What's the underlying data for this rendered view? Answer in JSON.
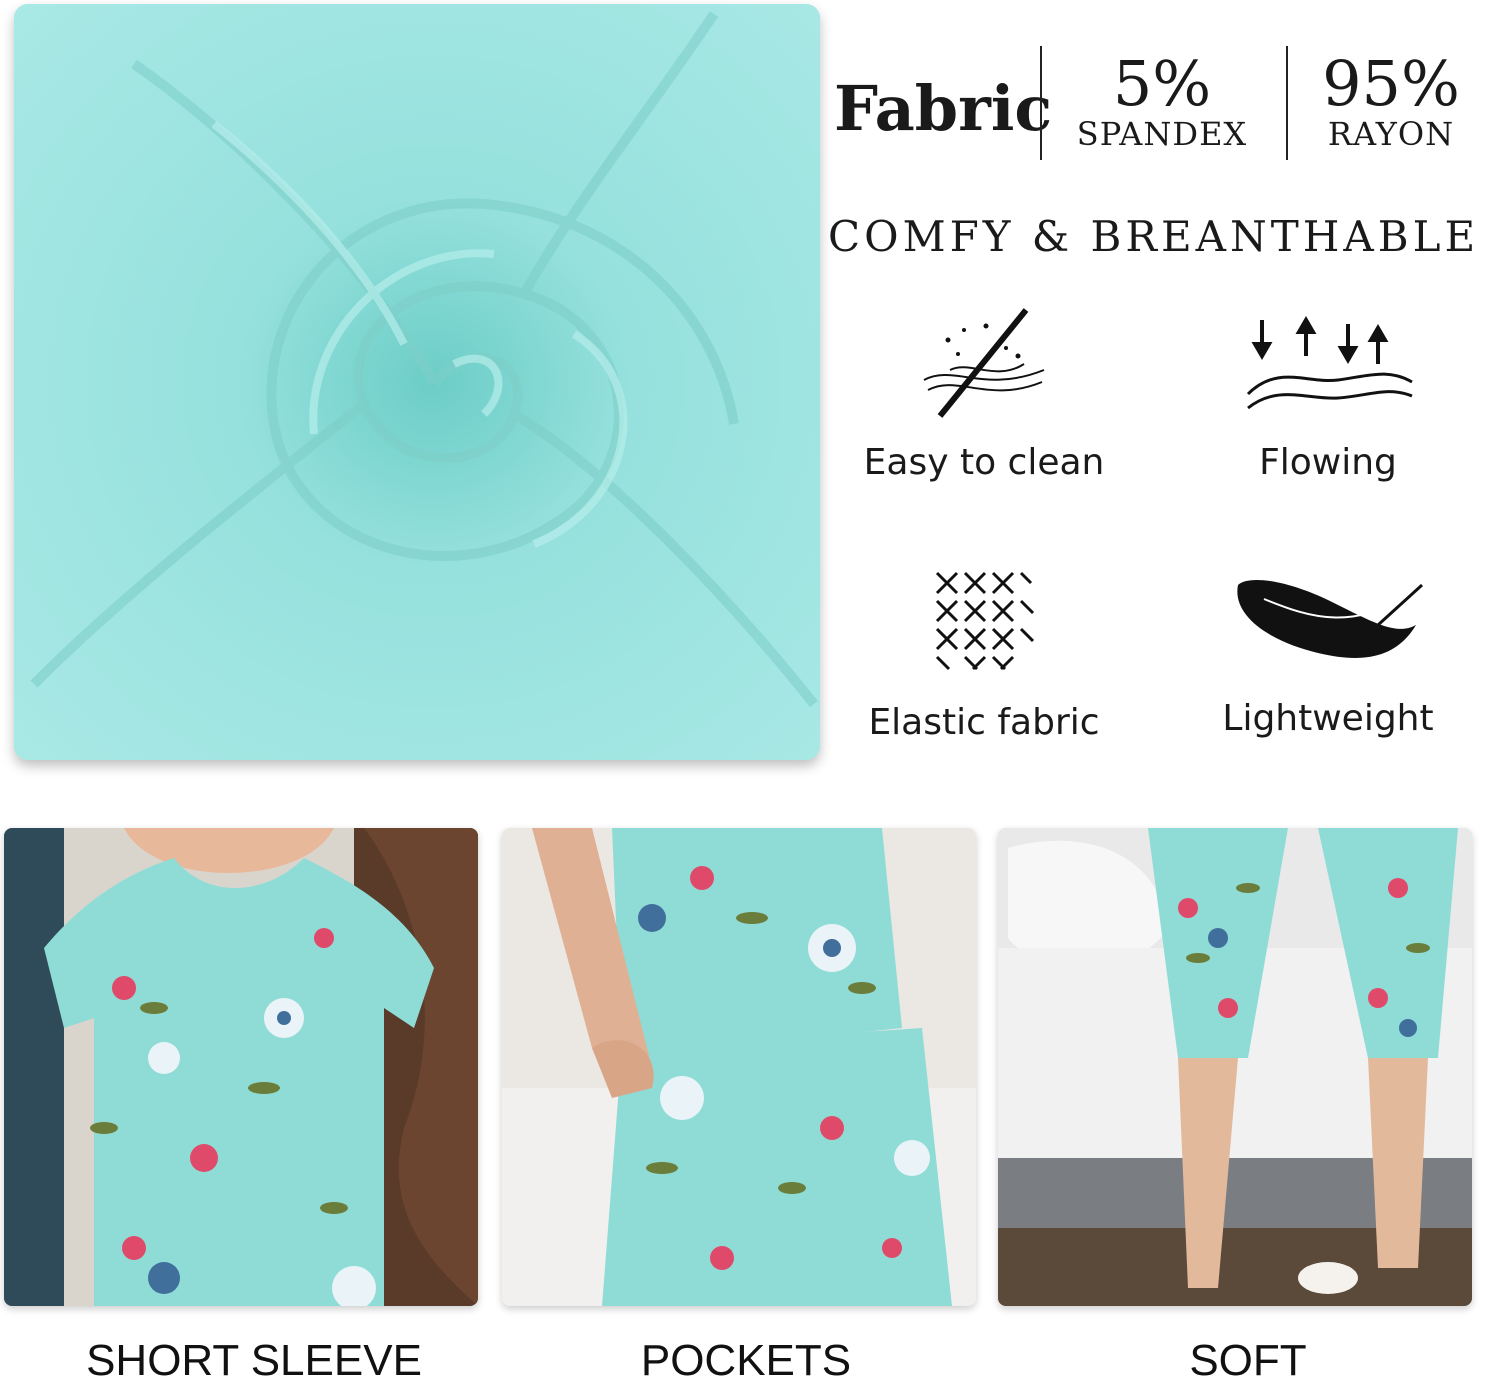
{
  "spec": {
    "fabric_title": "Fabric",
    "composition": [
      {
        "percent": "5%",
        "material": "SPANDEX"
      },
      {
        "percent": "95%",
        "material": "RAYON"
      }
    ]
  },
  "tagline": "COMFY & BREANTHABLE",
  "features": [
    {
      "label": "Easy to clean",
      "icon": "easy-clean-icon"
    },
    {
      "label": "Flowing",
      "icon": "flowing-icon"
    },
    {
      "label": "Elastic fabric",
      "icon": "elastic-weave-icon"
    },
    {
      "label": "Lightweight",
      "icon": "feather-icon"
    }
  ],
  "photos": [
    {
      "caption": "SHORT SLEEVE"
    },
    {
      "caption": "POCKETS"
    },
    {
      "caption": "SOFT"
    }
  ],
  "colors": {
    "fabric": "#9fe2de",
    "print_base": "#8fdcd6",
    "text": "#1a1a1a"
  }
}
